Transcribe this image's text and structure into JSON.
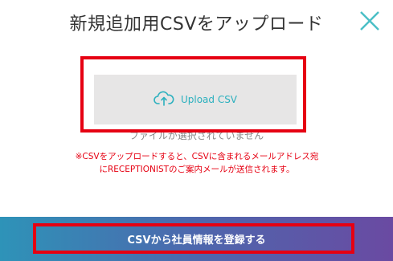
{
  "modal": {
    "title": "新規追加用CSVをアップロード",
    "close_icon": "close-icon"
  },
  "upload": {
    "icon": "cloud-upload-icon",
    "label": "Upload CSV",
    "file_status": "ファイルが選択されていません"
  },
  "notice": {
    "text": "※CSVをアップロードすると、CSVに含まれるメールアドレス宛にRECEPTIONISTのご案内メールが送信されます。"
  },
  "footer": {
    "register_label": "CSVから社員情報を登録する"
  },
  "colors": {
    "accent": "#2bb0be",
    "highlight": "#e60012",
    "gradient_start": "#2e93b8",
    "gradient_end": "#6a4aa2"
  }
}
